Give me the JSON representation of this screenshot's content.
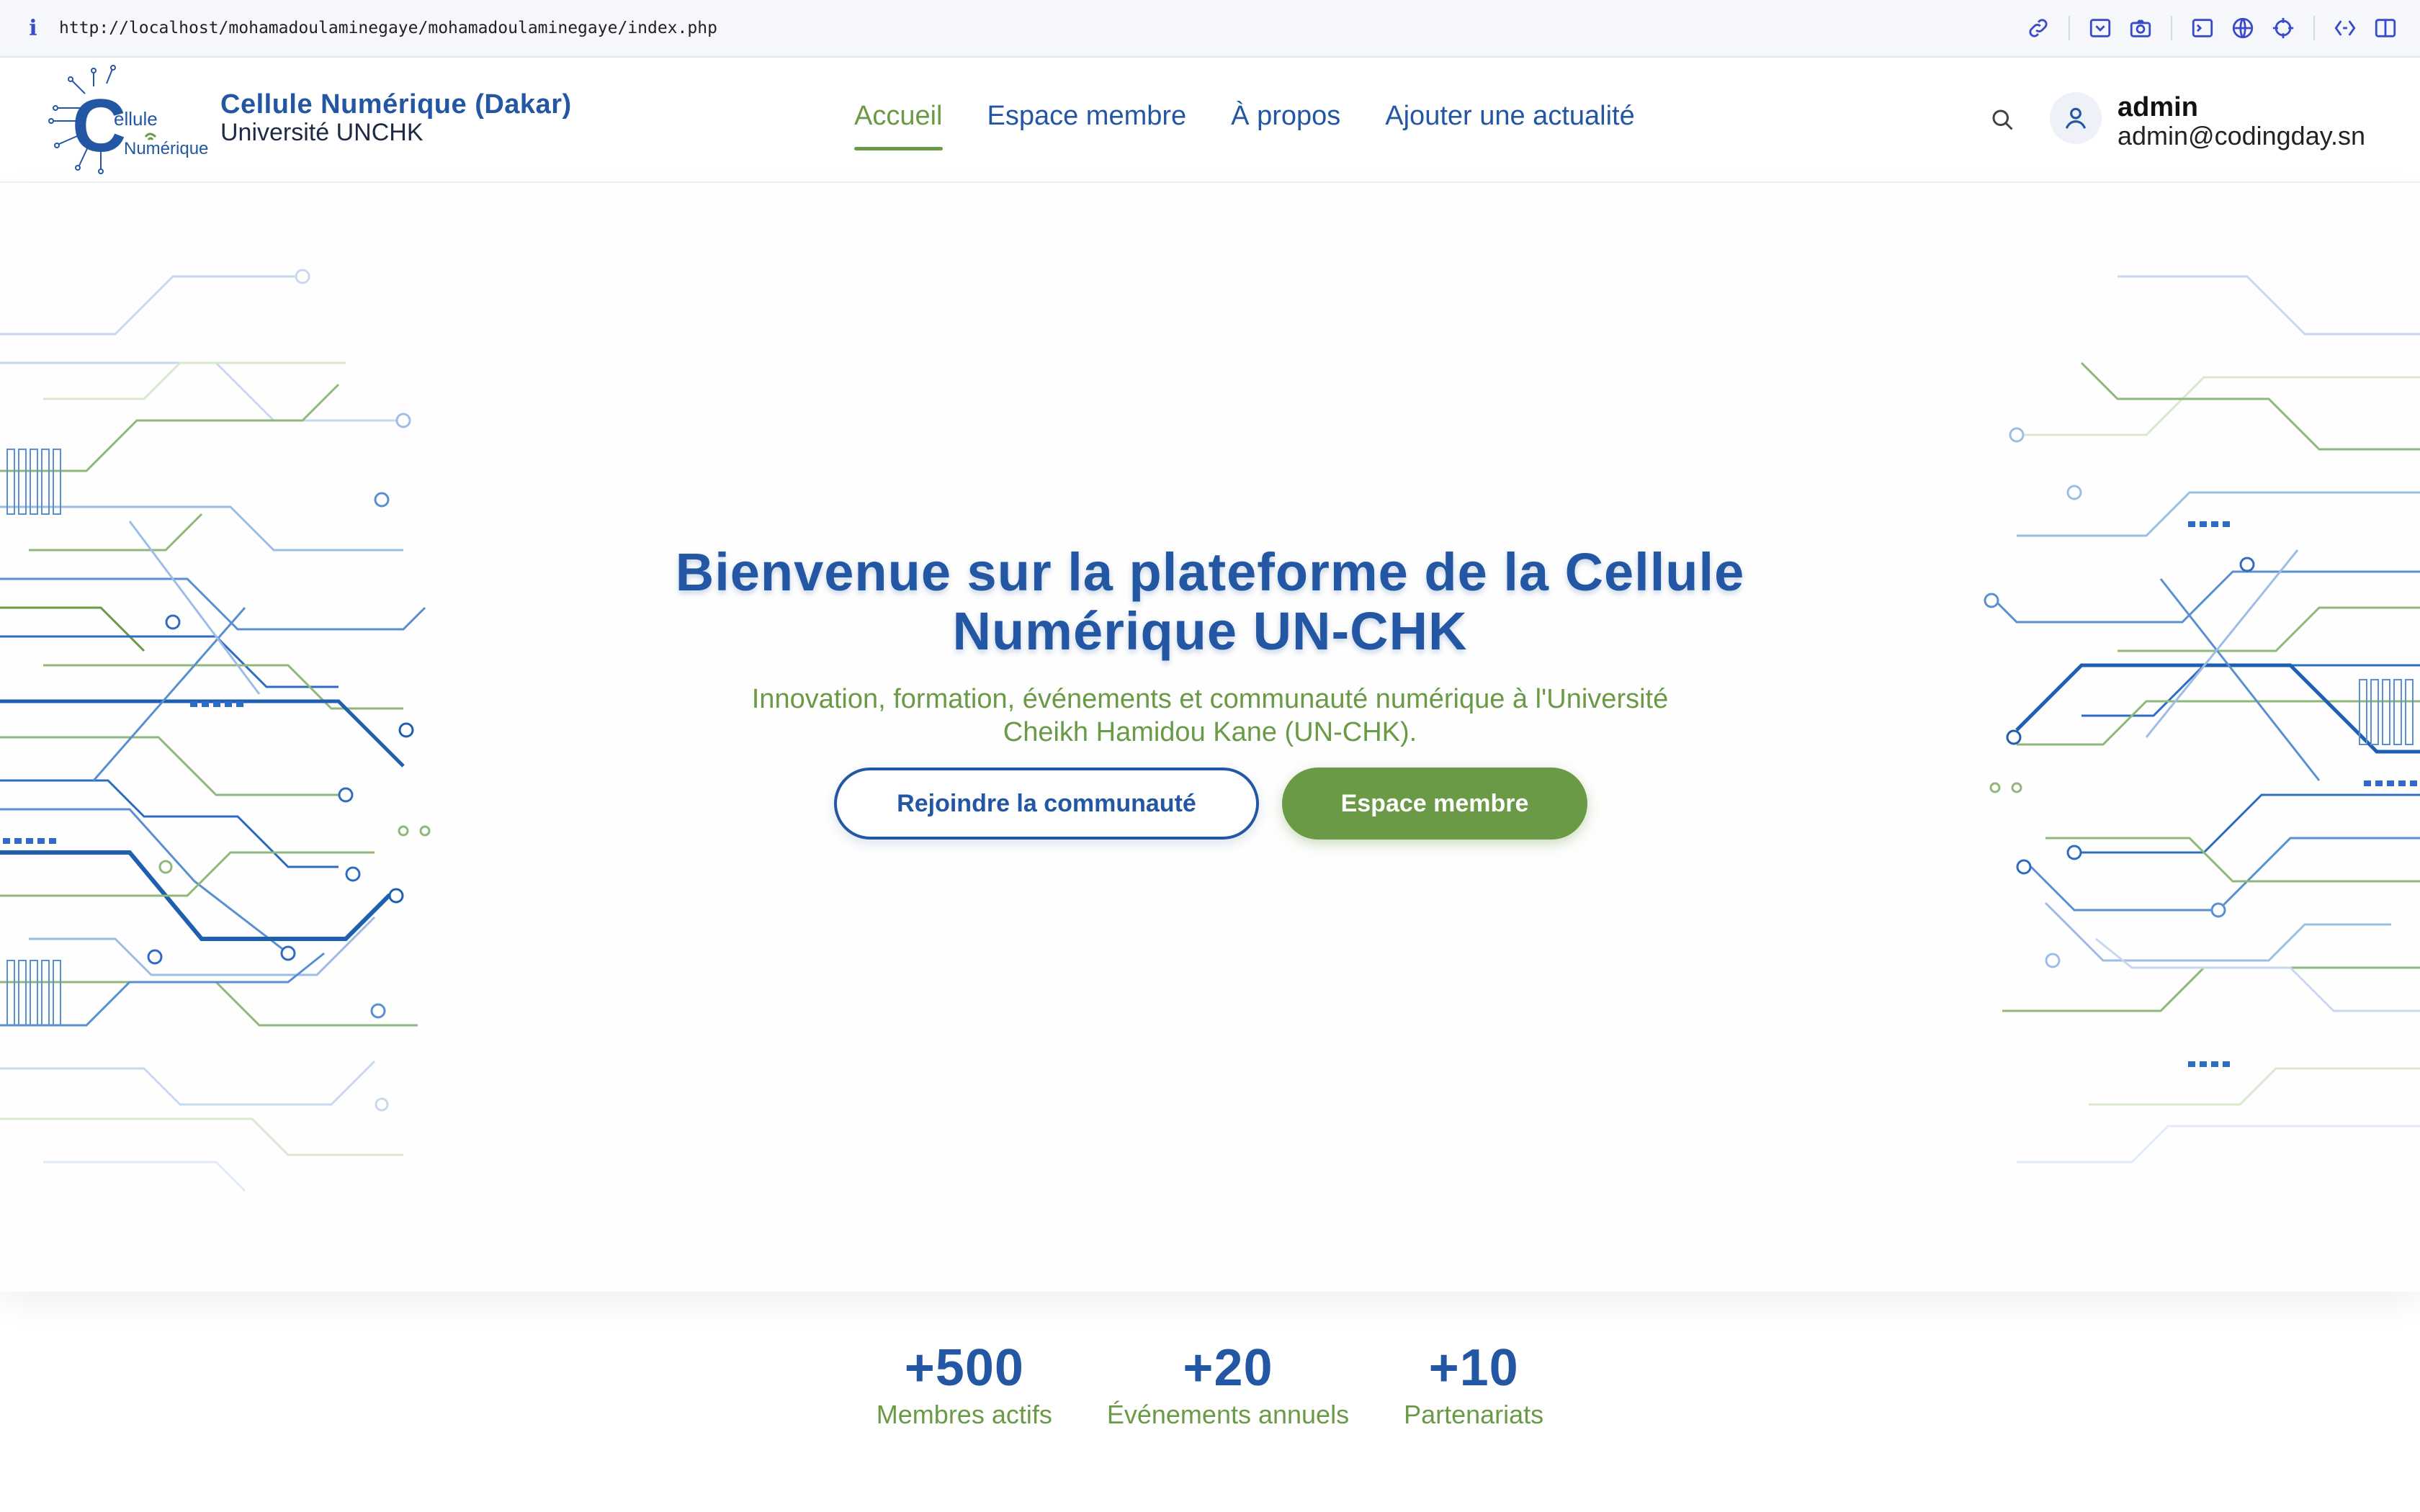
{
  "browser": {
    "url": "http://localhost/mohamadoulaminegaye/mohamadoulaminegaye/index.php",
    "info_icon": "i"
  },
  "brand": {
    "logo_word1": "ellule",
    "logo_letter": "C",
    "logo_word2": "Numérique",
    "title": "Cellule Numérique (Dakar)",
    "subtitle": "Université UNCHK"
  },
  "nav": {
    "items": [
      {
        "label": "Accueil",
        "active": true
      },
      {
        "label": "Espace membre",
        "active": false
      },
      {
        "label": "À propos",
        "active": false
      },
      {
        "label": "Ajouter une actualité",
        "active": false
      }
    ]
  },
  "user": {
    "name": "admin",
    "email": "admin@codingday.sn"
  },
  "hero": {
    "title": "Bienvenue sur la plateforme de la Cellule Numérique UN-CHK",
    "subtitle": "Innovation, formation, événements et communauté numérique à l'Université Cheikh Hamidou Kane (UN-CHK).",
    "primary_button": "Rejoindre la communauté",
    "secondary_button": "Espace membre"
  },
  "stats": [
    {
      "value": "+500",
      "label": "Membres actifs"
    },
    {
      "value": "+20",
      "label": "Événements annuels"
    },
    {
      "value": "+10",
      "label": "Partenariats"
    }
  ],
  "colors": {
    "primary_blue": "#2357a3",
    "accent_green": "#6a9a45",
    "background": "#ffffff"
  },
  "icons": {
    "search": "search-icon",
    "user": "user-icon",
    "toolbar": [
      "link-icon",
      "screenshot-icon",
      "camera-icon",
      "terminal-icon",
      "globe-icon",
      "crosshair-icon",
      "extensions-icon",
      "sidebar-icon"
    ]
  }
}
